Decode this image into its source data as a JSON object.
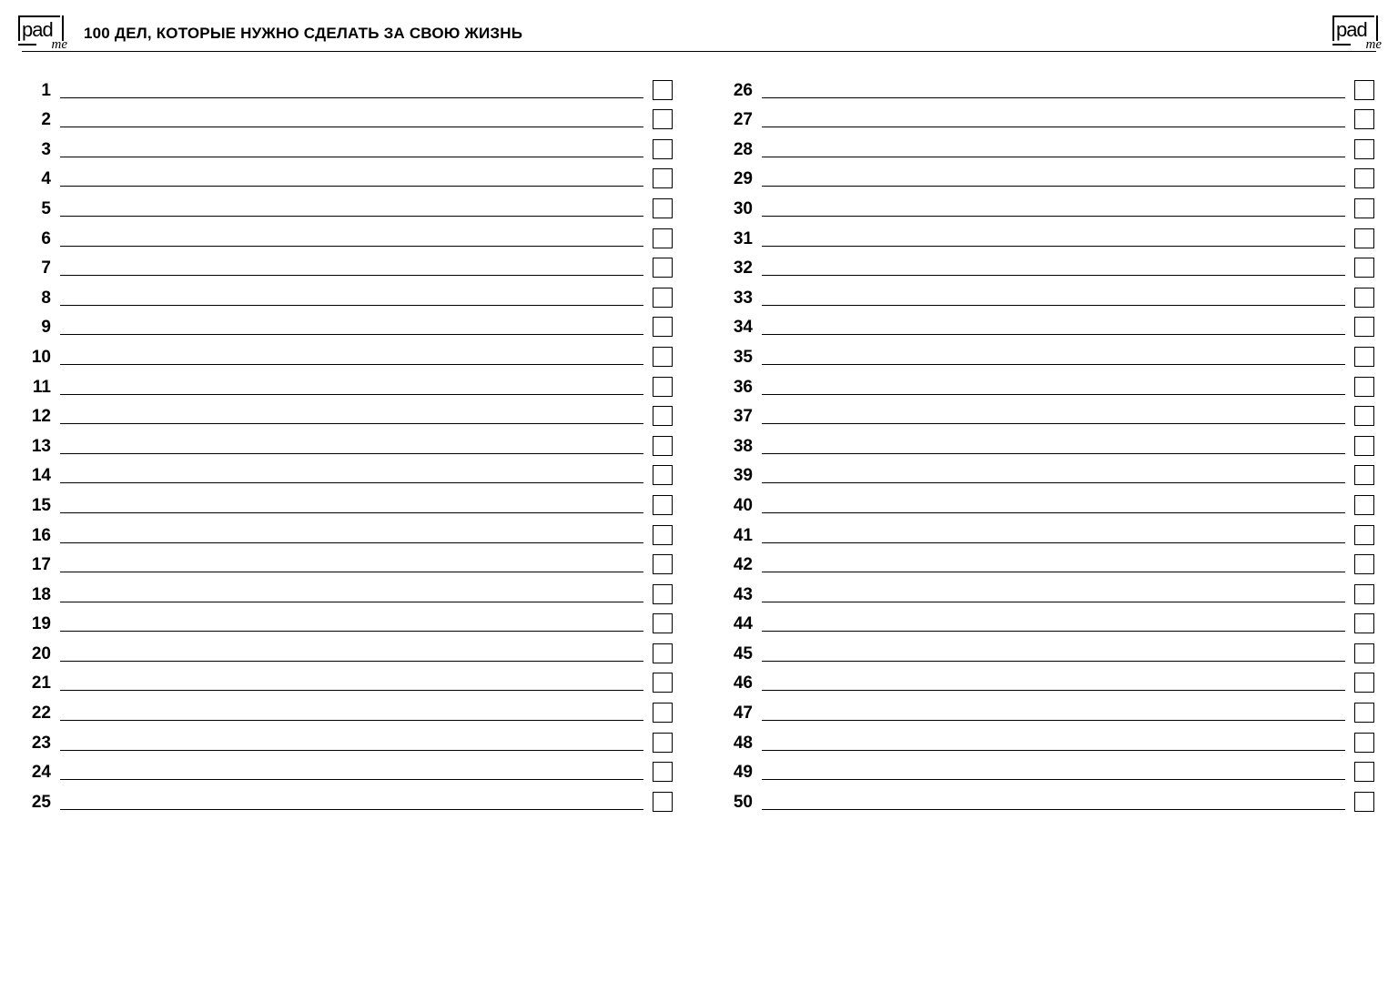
{
  "logo": {
    "brand": "pad",
    "suffix": "me"
  },
  "title": "100 ДЕЛ, КОТОРЫЕ НУЖНО СДЕЛАТЬ ЗА СВОЮ ЖИЗНЬ",
  "columns": {
    "left": {
      "start": 1,
      "end": 25
    },
    "right": {
      "start": 26,
      "end": 50
    }
  },
  "n": {
    "1": "1",
    "2": "2",
    "3": "3",
    "4": "4",
    "5": "5",
    "6": "6",
    "7": "7",
    "8": "8",
    "9": "9",
    "10": "10",
    "11": "11",
    "12": "12",
    "13": "13",
    "14": "14",
    "15": "15",
    "16": "16",
    "17": "17",
    "18": "18",
    "19": "19",
    "20": "20",
    "21": "21",
    "22": "22",
    "23": "23",
    "24": "24",
    "25": "25",
    "26": "26",
    "27": "27",
    "28": "28",
    "29": "29",
    "30": "30",
    "31": "31",
    "32": "32",
    "33": "33",
    "34": "34",
    "35": "35",
    "36": "36",
    "37": "37",
    "38": "38",
    "39": "39",
    "40": "40",
    "41": "41",
    "42": "42",
    "43": "43",
    "44": "44",
    "45": "45",
    "46": "46",
    "47": "47",
    "48": "48",
    "49": "49",
    "50": "50"
  }
}
